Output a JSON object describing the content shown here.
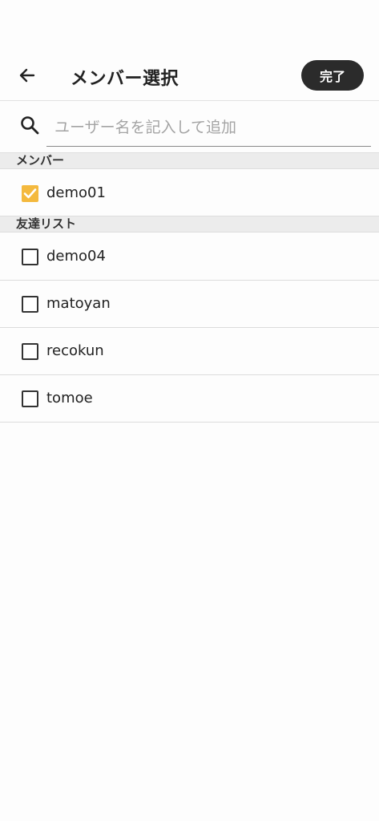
{
  "header": {
    "title": "メンバー選択",
    "done_label": "完了",
    "back_icon": "arrow-left-icon"
  },
  "search": {
    "placeholder": "ユーザー名を記入して追加",
    "value": "",
    "icon": "search-icon"
  },
  "members": {
    "header": "メンバー",
    "items": [
      {
        "name": "demo01",
        "checked": true
      }
    ]
  },
  "friends": {
    "header": "友達リスト",
    "items": [
      {
        "name": "demo04",
        "checked": false
      },
      {
        "name": "matoyan",
        "checked": false
      },
      {
        "name": "recokun",
        "checked": false
      },
      {
        "name": "tomoe",
        "checked": false
      }
    ]
  },
  "colors": {
    "accent_checked": "#f4b93e",
    "done_button": "#2b2b2b"
  }
}
